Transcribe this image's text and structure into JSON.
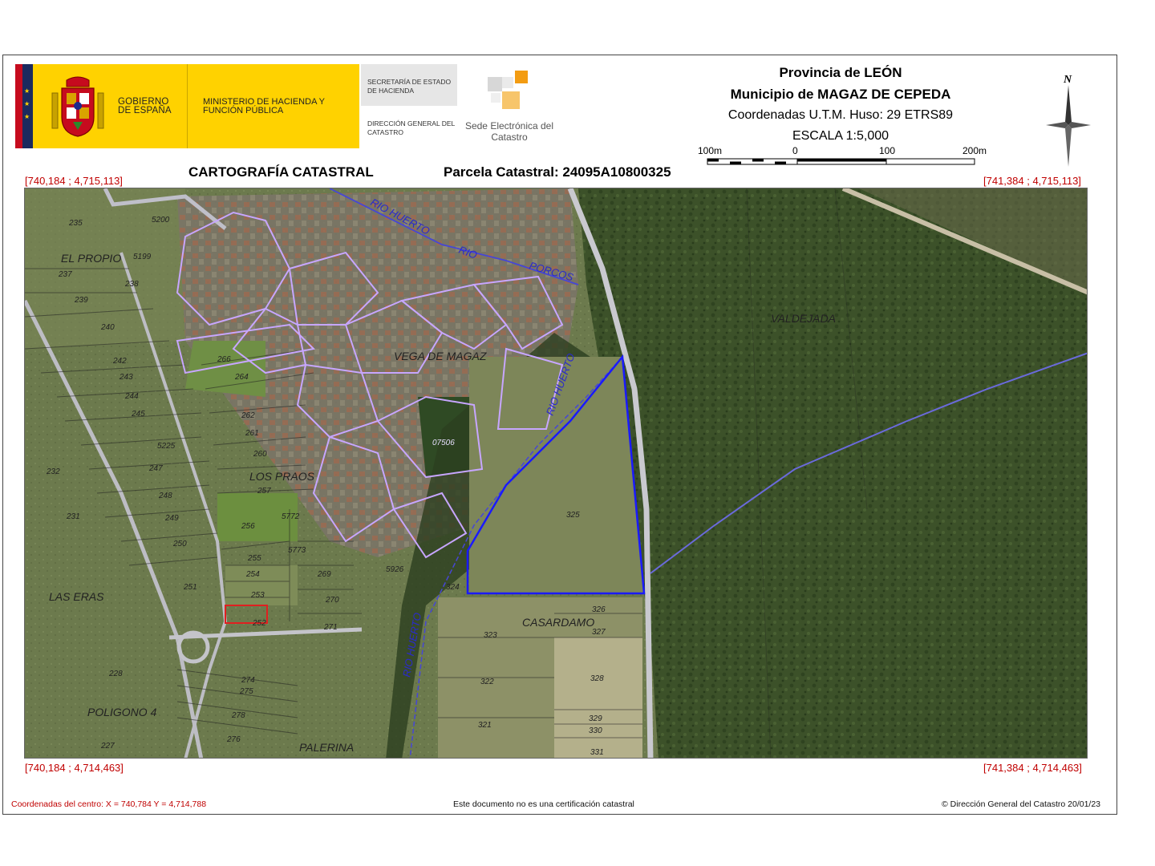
{
  "header": {
    "gov_label": "GOBIERNO DE ESPAÑA",
    "ministry_label": "MINISTERIO DE HACIENDA Y FUNCIÓN PÚBLICA",
    "secretaria_label": "SECRETARÍA DE ESTADO DE HACIENDA",
    "direccion_label": "DIRECCIÓN GENERAL DEL CATASTRO",
    "sede_label": "Sede Electrónica del Catastro",
    "provincia": "Provincia de LEÓN",
    "municipio": "Municipio de MAGAZ DE CEPEDA",
    "coordenadas": "Coordenadas U.T.M. Huso: 29 ETRS89",
    "escala": "ESCALA 1:5,000",
    "scale_labels": [
      "100m",
      "0",
      "100",
      "200m"
    ],
    "north_label": "N"
  },
  "titles": {
    "cartografia": "CARTOGRAFÍA CATASTRAL",
    "parcela": "Parcela Catastral: 24095A10800325"
  },
  "corners": {
    "top_left": "[740,184 ; 4,715,113]",
    "top_right": "[741,384 ; 4,715,113]",
    "bottom_left": "[740,184 ; 4,714,463]",
    "bottom_right": "[741,384 ; 4,714,463]"
  },
  "map": {
    "place_names": [
      "EL PROPIO",
      "VEGA DE MAGAZ",
      "LOS PRAOS",
      "LAS ERAS",
      "POLIGONO 4",
      "PALERINA",
      "CASARDAMO",
      "VALDEJADA"
    ],
    "river_labels": [
      "RIO HUERTO",
      "RIO",
      "PORCOS",
      "RIO HUERTO",
      "RIO HUERTO"
    ],
    "parcel_numbers": [
      "235",
      "5199",
      "5200",
      "237",
      "238",
      "239",
      "240",
      "242",
      "243",
      "244",
      "245",
      "5225",
      "247",
      "248",
      "249",
      "250",
      "251",
      "232",
      "231",
      "266",
      "264",
      "262",
      "261",
      "260",
      "257",
      "256",
      "255",
      "254",
      "253",
      "252",
      "269",
      "270",
      "271",
      "5772",
      "5773",
      "228",
      "227",
      "274",
      "275",
      "276",
      "278",
      "07506",
      "325",
      "324",
      "326",
      "327",
      "323",
      "322",
      "321",
      "328",
      "329",
      "330",
      "331",
      "5926"
    ],
    "selected_parcel": "325"
  },
  "footer": {
    "center_coords": "Coordenadas del centro: X = 740,784 Y = 4,714,788",
    "disclaimer": "Este documento no es una certificación catastral",
    "copyright": "© Dirección General del Catastro 20/01/23"
  },
  "colors": {
    "gov_yellow": "#ffd200",
    "spain_red": "#c60b1e",
    "boundary_red": "#c00000",
    "parcel_outline": "#1a1aff",
    "river_label": "#2a2acc",
    "urban_outline": "#c7a6ff"
  }
}
